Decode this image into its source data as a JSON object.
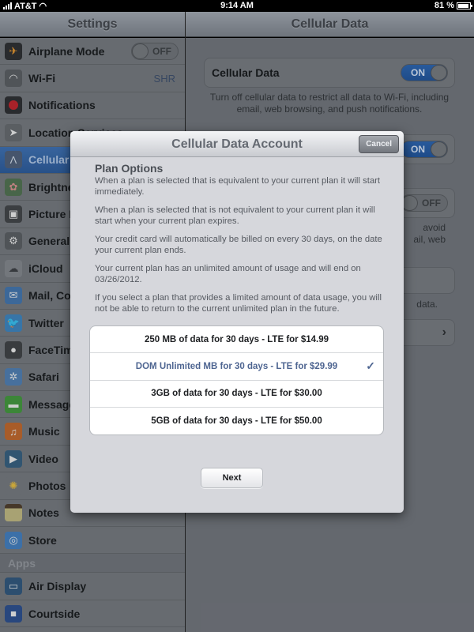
{
  "status_bar": {
    "carrier": "AT&T",
    "time": "9:14 AM",
    "battery": "81 %",
    "battery_level_percent": 81
  },
  "left_nav": {
    "title": "Settings"
  },
  "right_nav": {
    "title": "Cellular Data"
  },
  "sidebar": {
    "items": [
      {
        "label": "Airplane Mode",
        "icon": "airplane-icon",
        "switch": "OFF"
      },
      {
        "label": "Wi-Fi",
        "icon": "wifi-icon",
        "value": "SHR"
      },
      {
        "label": "Notifications",
        "icon": "notifications-icon"
      },
      {
        "label": "Location Services",
        "icon": "location-icon"
      },
      {
        "label": "Cellular",
        "icon": "cellular-icon",
        "selected": true
      },
      {
        "label": "Brightness & Wallpaper",
        "icon": "brightness-icon"
      },
      {
        "label": "Picture Frame",
        "icon": "picture-frame-icon"
      },
      {
        "label": "General",
        "icon": "gear-icon"
      },
      {
        "label": "iCloud",
        "icon": "icloud-icon"
      },
      {
        "label": "Mail, Contacts, Calendars",
        "icon": "mail-icon"
      },
      {
        "label": "Twitter",
        "icon": "twitter-icon"
      },
      {
        "label": "FaceTime",
        "icon": "facetime-icon"
      },
      {
        "label": "Safari",
        "icon": "safari-icon"
      },
      {
        "label": "Messages",
        "icon": "messages-icon"
      },
      {
        "label": "Music",
        "icon": "music-icon"
      },
      {
        "label": "Video",
        "icon": "video-icon"
      },
      {
        "label": "Photos",
        "icon": "photos-icon"
      },
      {
        "label": "Notes",
        "icon": "notes-icon"
      },
      {
        "label": "Store",
        "icon": "store-icon"
      }
    ],
    "apps_header": "Apps",
    "apps": [
      {
        "label": "Air Display",
        "icon": "air-display-icon"
      },
      {
        "label": "Courtside",
        "icon": "courtside-icon"
      }
    ]
  },
  "detail": {
    "cellular_data_label": "Cellular Data",
    "cellular_data_switch": "ON",
    "cellular_data_footnote": "Turn off cellular data to restrict all data to Wi-Fi, including email, web browsing, and push notifications.",
    "second_switch": "ON",
    "third_switch": "OFF",
    "third_footnote_partial": "avoid ...ail, web",
    "fourth_footnote_partial": "...data."
  },
  "modal": {
    "title": "Cellular Data Account",
    "cancel_label": "Cancel",
    "section_title": "Plan Options",
    "paragraphs": [
      "When a plan is selected that is equivalent to your current plan it will start immediately.",
      "When a plan is selected that is not equivalent to your current plan it will start when your current plan expires.",
      "Your credit card will automatically be billed on every 30 days, on the date your current plan ends.",
      "Your current plan has an unlimited amount of usage and will end on 03/26/2012.",
      "If you select a plan that provides a limited amount of data usage, you will not be able to return to the current unlimited plan in the future."
    ],
    "plans": [
      {
        "label": "250 MB of data for 30 days - LTE for $14.99",
        "selected": false
      },
      {
        "label": "DOM Unlimited MB for 30 days - LTE for $29.99",
        "selected": true
      },
      {
        "label": "3GB of data for 30 days - LTE for $30.00",
        "selected": false
      },
      {
        "label": "5GB of data for 30 days - LTE for $50.00",
        "selected": false
      }
    ],
    "checkmark": "✓",
    "next_label": "Next"
  },
  "colors": {
    "selected_row": "#2a5591",
    "switch_on": "#1f4f92",
    "selected_plan_text": "#4e6591"
  }
}
